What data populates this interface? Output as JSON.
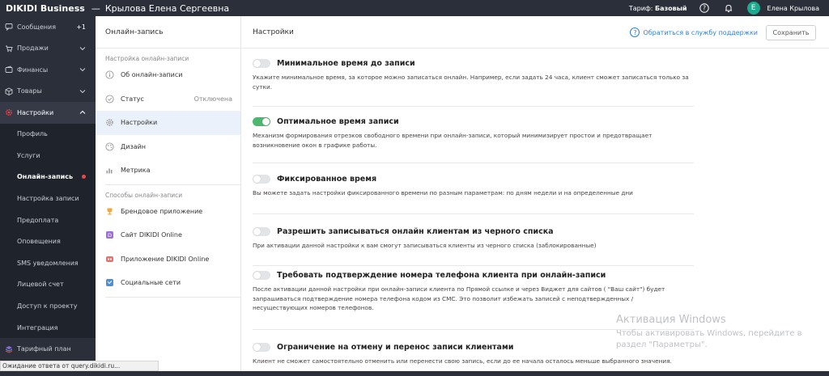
{
  "header": {
    "brand": "DIKIDI Business",
    "separator": "—",
    "user_title": "Крылова Елена Сергеевна",
    "tariff_label": "Тариф:",
    "tariff_value": "Базовый",
    "avatar_letter": "E",
    "user_name": "Елена Крылова"
  },
  "sidebar": {
    "items": [
      {
        "label": "Сообщения",
        "badge": "+1",
        "icon": "chat-icon"
      },
      {
        "label": "Продажи",
        "icon": "cart-icon"
      },
      {
        "label": "Финансы",
        "icon": "wallet-icon"
      },
      {
        "label": "Товары",
        "icon": "box-icon"
      },
      {
        "label": "Настройки",
        "icon": "gear-icon"
      }
    ],
    "subitems": [
      {
        "label": "Профиль"
      },
      {
        "label": "Услуги"
      },
      {
        "label": "Онлайн-запись"
      },
      {
        "label": "Настройка записи"
      },
      {
        "label": "Предоплата"
      },
      {
        "label": "Оповещения"
      },
      {
        "label": "SMS уведомления"
      },
      {
        "label": "Лицевой счет"
      },
      {
        "label": "Доступ к проекту"
      },
      {
        "label": "Интеграция"
      }
    ],
    "bottom_item": {
      "label": "Тарифный план",
      "icon": "layers-icon"
    }
  },
  "middle": {
    "title": "Онлайн-запись",
    "section1": "Настройка онлайн-записи",
    "items1": [
      {
        "label": "Об онлайн-записи",
        "icon": "info-icon"
      },
      {
        "label": "Статус",
        "status": "Отключена",
        "icon": "check-circle-icon"
      },
      {
        "label": "Настройки",
        "icon": "gear-icon"
      },
      {
        "label": "Дизайн",
        "icon": "palette-icon"
      },
      {
        "label": "Метрика",
        "icon": "bar-chart-icon"
      }
    ],
    "section2": "Способы онлайн-записи",
    "items2": [
      {
        "label": "Брендовое приложение",
        "icon": "trophy-icon"
      },
      {
        "label": "Сайт DIKIDI Online",
        "icon": "site-icon"
      },
      {
        "label": "Приложение DIKIDI Online",
        "icon": "app-icon"
      },
      {
        "label": "Социальные сети",
        "icon": "social-icon"
      }
    ]
  },
  "content": {
    "title": "Настройки",
    "support_link": "Обратиться в службу поддержки",
    "save_label": "Сохранить",
    "settings": [
      {
        "title": "Минимальное время до записи",
        "desc": "Укажите минимальное время, за которое можно записаться онлайн. Например, если задать 24 часа, клиент сможет записаться только за сутки.",
        "enabled": false
      },
      {
        "title": "Оптимальное время записи",
        "desc": "Механизм формирования отрезков свободного времени при онлайн-записи, который минимизирует простои и предотвращает возникновение окон в графике работы.",
        "enabled": true
      },
      {
        "title": "Фиксированное время",
        "desc": "Вы можете задать настройки фиксированного времени по разным параметрам: по дням недели и на определенные дни",
        "enabled": false
      },
      {
        "title": "Разрешить записываться онлайн клиентам из черного списка",
        "desc": "При активации данной настройки к вам смогут записываться клиенты из черного списка (заблокированные)",
        "enabled": false
      },
      {
        "title": "Требовать подтверждение номера телефона клиента при онлайн-записи",
        "desc": "После активации данной настройки при онлайн-записи клиента по Прямой ссылке и через Виджет для сайтов ( \"Ваш сайт\") будет запрашиваться подтверждение номера телефона кодом из СМС. Это позволит избежать записей с неподтвержденных / несуществующих номеров телефонов.",
        "enabled": false
      },
      {
        "title": "Ограничение на отмену и перенос записи клиентами",
        "desc": "Клиент не сможет самостоятельно отменить или перенести свою запись, если до ее начала осталось меньше выбранного значения.",
        "enabled": false
      }
    ]
  },
  "watermark": {
    "line1": "Активация Windows",
    "line2": "Чтобы активировать Windows, перейдите в",
    "line3": "раздел \"Параметры\"."
  },
  "statusbar": "Ожидание ответа от query.dikidi.ru..."
}
